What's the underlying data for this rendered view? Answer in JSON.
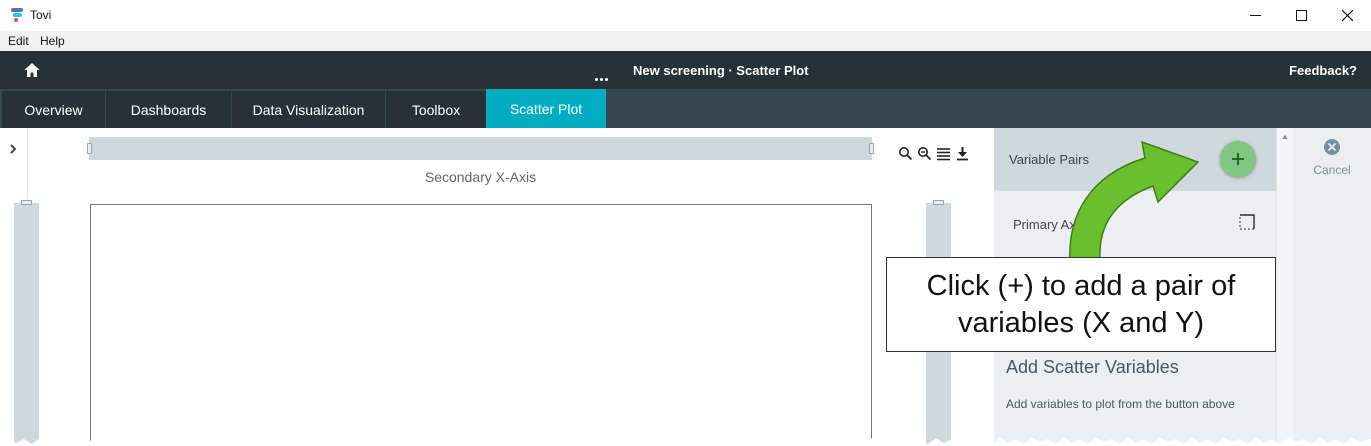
{
  "window": {
    "title": "Tovi",
    "icons": [
      "tovi-logo-icon",
      "minimize-icon",
      "maximize-icon",
      "close-icon"
    ]
  },
  "menu": {
    "items": [
      "Edit",
      "Help"
    ]
  },
  "header": {
    "title": "New screening · Scatter Plot",
    "feedback": "Feedback?",
    "icons": [
      "home-icon",
      "more-icon"
    ]
  },
  "tabs": [
    {
      "label": "Overview",
      "active": false
    },
    {
      "label": "Dashboards",
      "active": false
    },
    {
      "label": "Data Visualization",
      "active": false
    },
    {
      "label": "Toolbox",
      "active": false
    },
    {
      "label": "Scatter Plot",
      "active": true
    }
  ],
  "chart": {
    "secondary_x_label": "Secondary X-Axis",
    "tool_icons": [
      "zoom-in-icon",
      "zoom-out-icon",
      "list-icon",
      "download-icon"
    ]
  },
  "panel": {
    "title": "Variable Pairs",
    "primary_axis": "Primary Ax",
    "add_title": "Add Scatter Variables",
    "add_desc": "Add variables to plot from the button above"
  },
  "cancel": {
    "label": "Cancel"
  },
  "callout": {
    "text": "Click (+) to add a pair of variables (X and Y)"
  },
  "colors": {
    "header_bg": "#263238",
    "tab_active": "#00acc1",
    "add_button": "#81c784",
    "arrow": "#6abf2e"
  }
}
